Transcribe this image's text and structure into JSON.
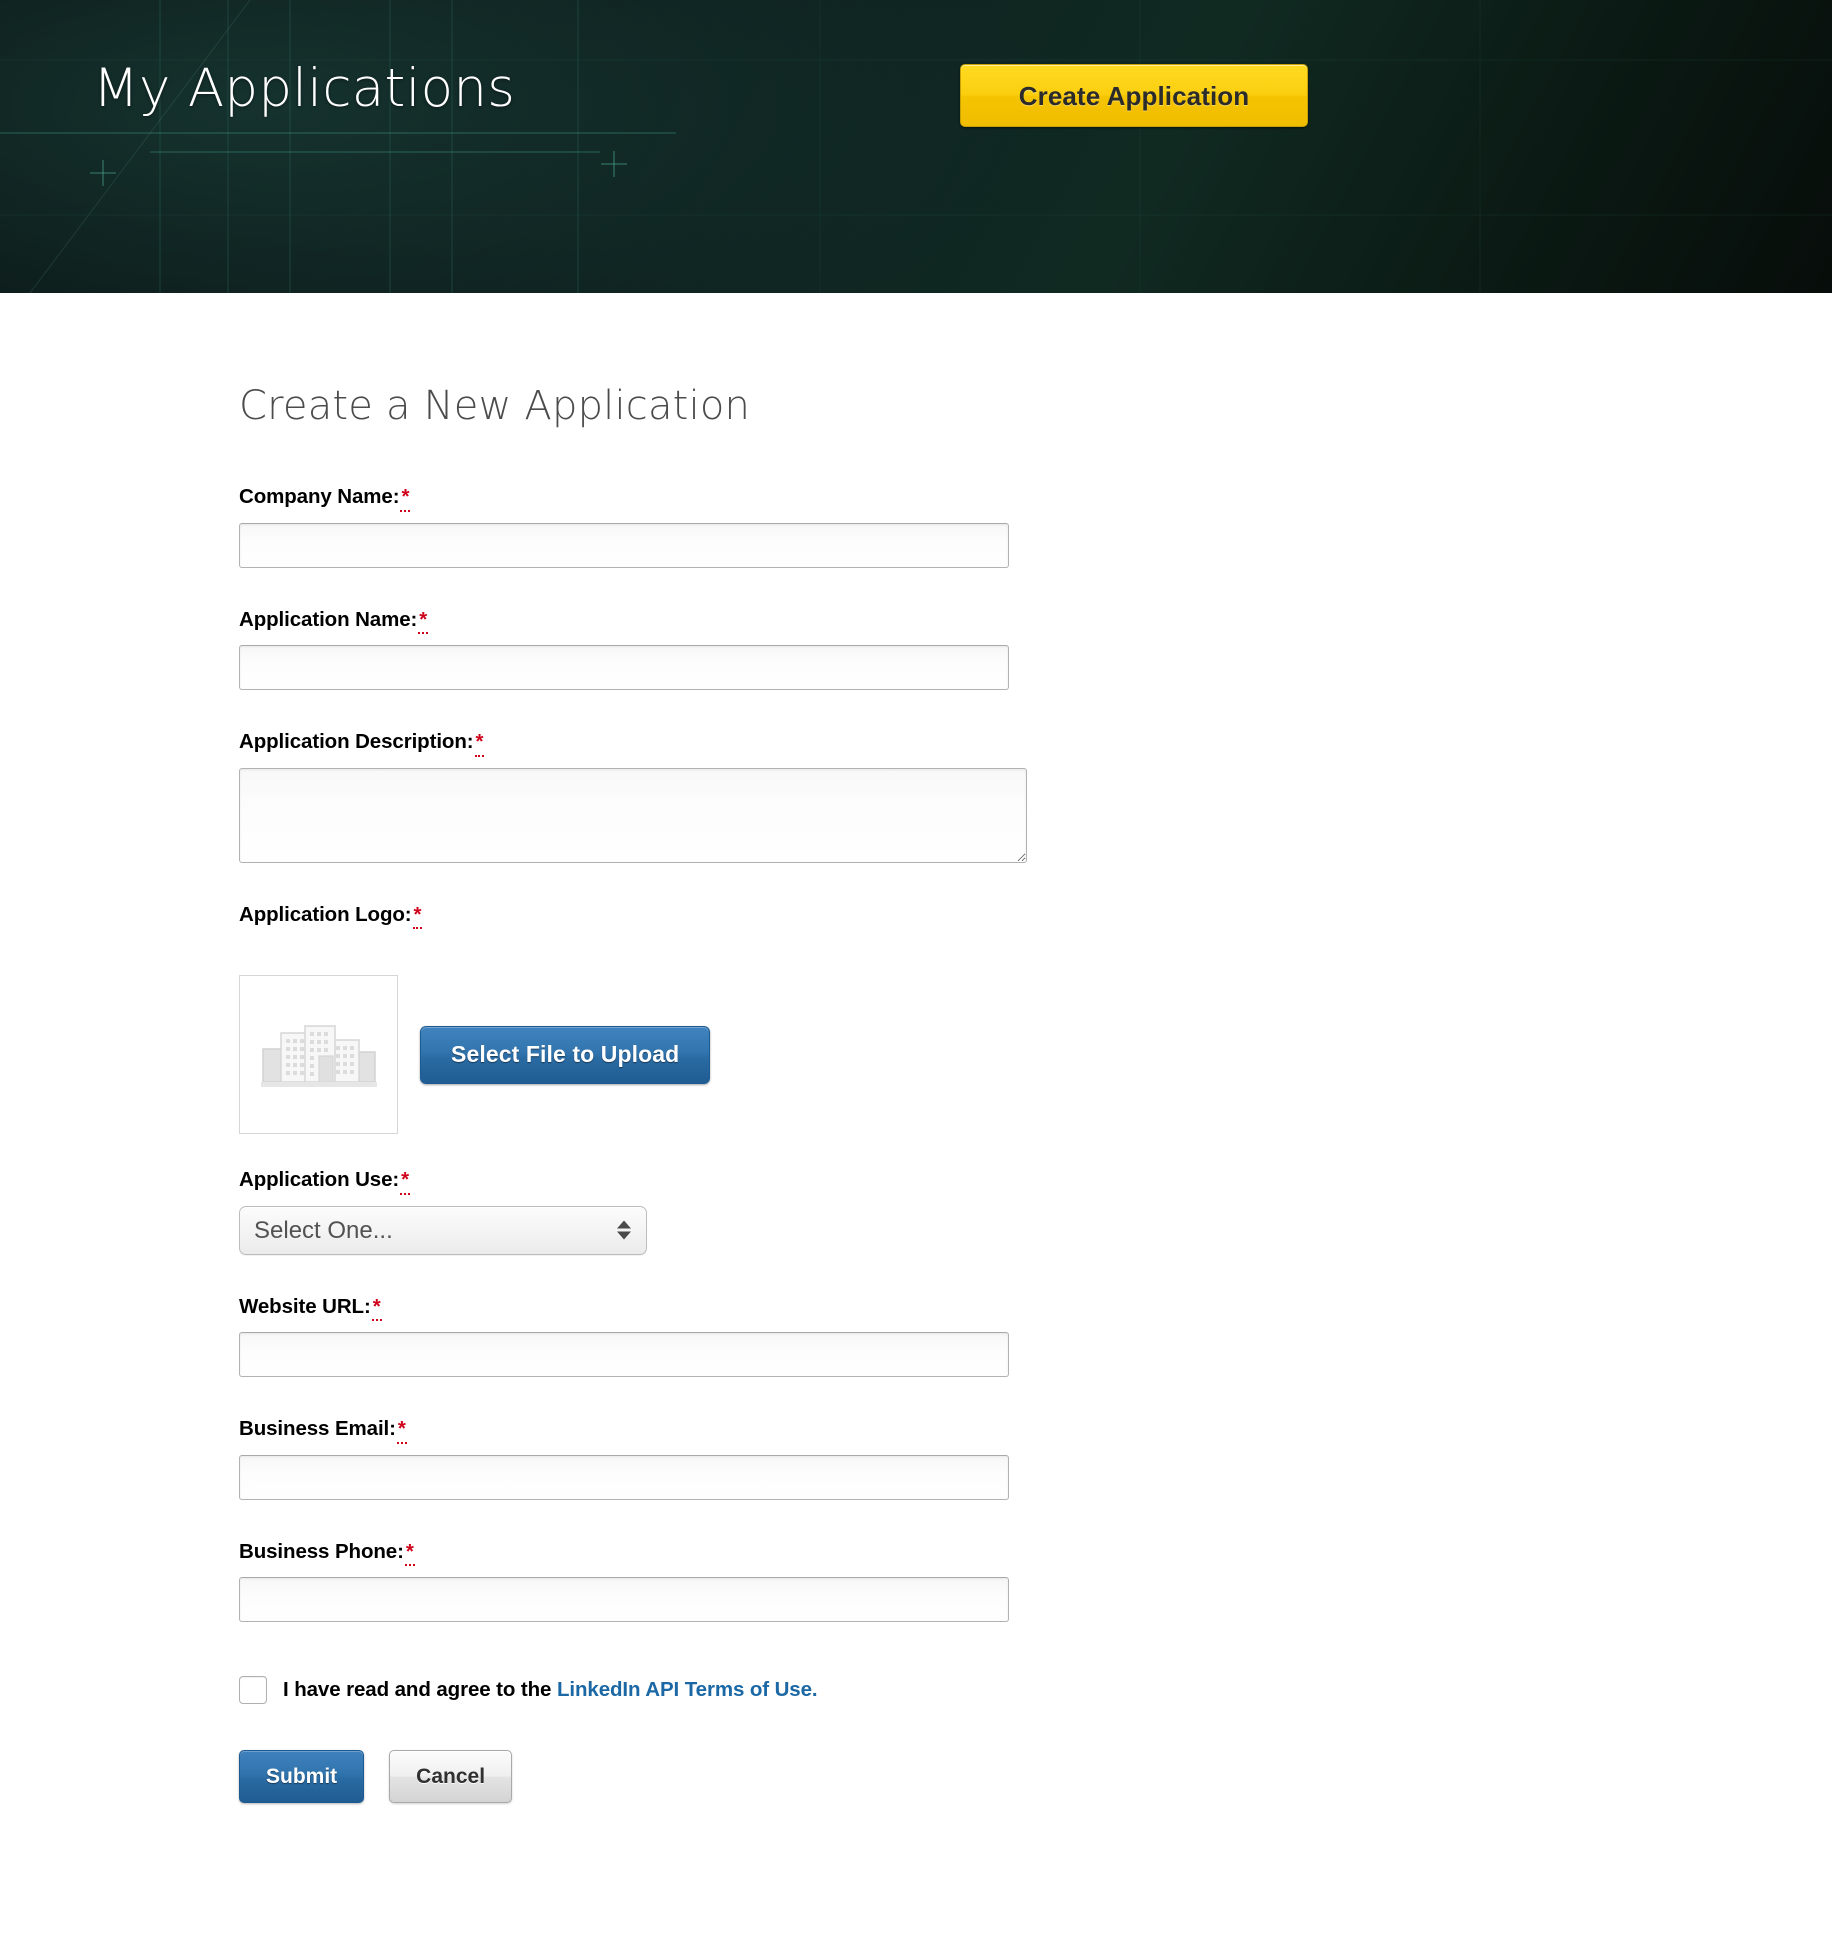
{
  "header": {
    "title": "My Applications",
    "create_button_label": "Create Application",
    "accent_color": "#f5c400",
    "background_color": "#0c1a18"
  },
  "form": {
    "title": "Create a New Application",
    "required_marker": "*",
    "fields": [
      {
        "label": "Company Name:",
        "type": "text",
        "value": "",
        "placeholder": ""
      },
      {
        "label": "Application Name:",
        "type": "text",
        "value": "",
        "placeholder": ""
      },
      {
        "label": "Application Description:",
        "type": "textarea",
        "value": "",
        "placeholder": ""
      },
      {
        "label": "Application Logo:",
        "type": "file"
      },
      {
        "label": "Application Use:",
        "type": "select"
      },
      {
        "label": "Website URL:",
        "type": "text",
        "value": "",
        "placeholder": ""
      },
      {
        "label": "Business Email:",
        "type": "text",
        "value": "",
        "placeholder": ""
      },
      {
        "label": "Business Phone:",
        "type": "text",
        "value": "",
        "placeholder": ""
      }
    ],
    "logo": {
      "placeholder_icon": "buildings-icon",
      "upload_button_label": "Select File to Upload"
    },
    "application_use": {
      "selected": "Select One...",
      "options": [
        "Select One..."
      ]
    },
    "agreement": {
      "checked": false,
      "text_before": "I have read and agree to the ",
      "link_text": "LinkedIn API Terms of Use."
    },
    "actions": {
      "submit_label": "Submit",
      "cancel_label": "Cancel",
      "submit_color": "#2a6aa2",
      "cancel_color": "#e3e3e3"
    }
  }
}
